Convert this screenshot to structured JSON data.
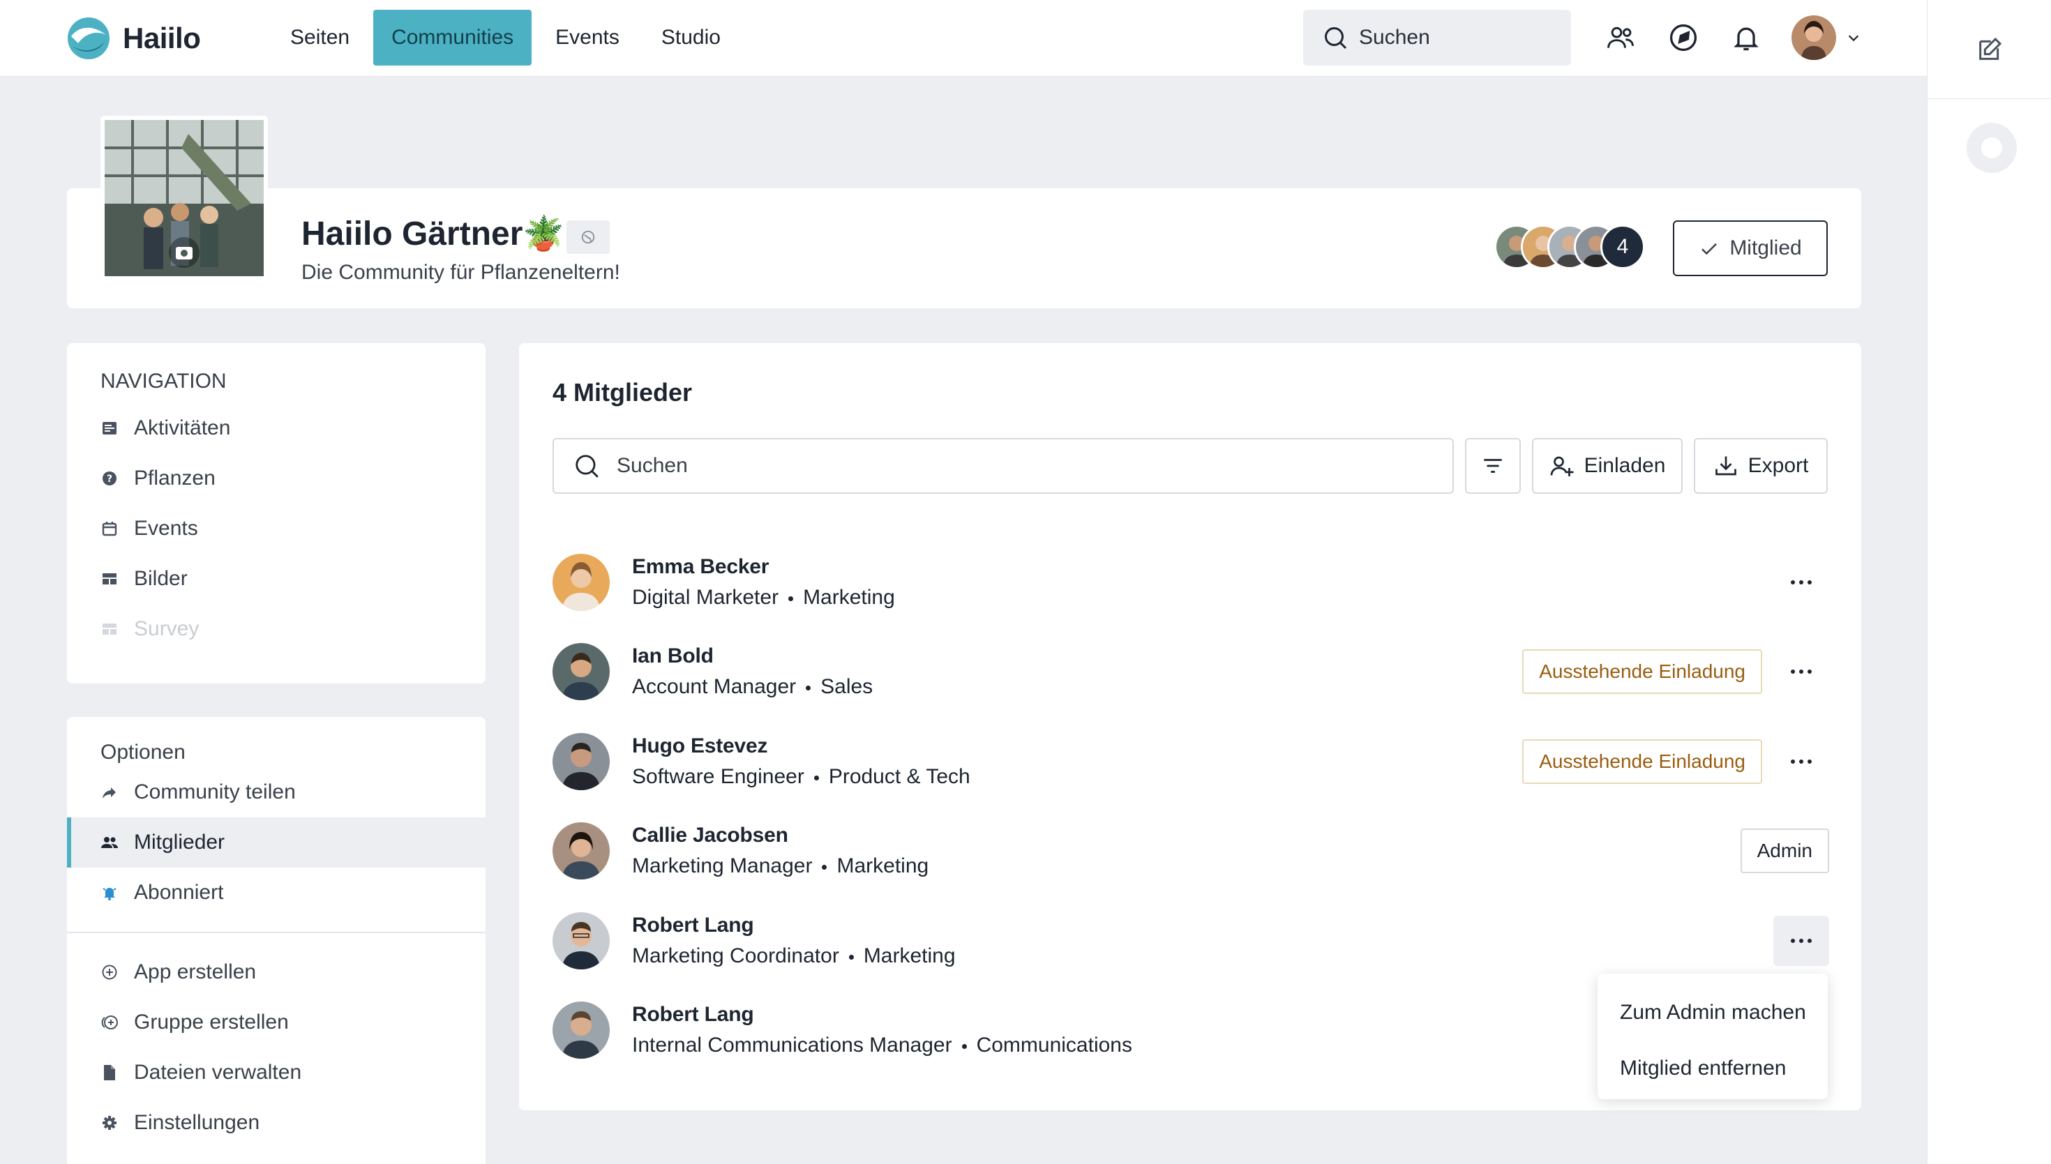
{
  "app": {
    "name": "Haiilo"
  },
  "nav": {
    "items": [
      "Seiten",
      "Communities",
      "Events",
      "Studio"
    ],
    "active": "Communities"
  },
  "top_search": {
    "placeholder": "Suchen"
  },
  "community": {
    "title": "Haiilo Gärtner🪴",
    "subtitle": "Die Community für Pflanzeneltern!",
    "member_count_badge": "4",
    "member_button": "Mitglied"
  },
  "sidebar": {
    "navigation_heading": "NAVIGATION",
    "navigation_items": [
      {
        "label": "Aktivitäten",
        "icon": "activity-icon"
      },
      {
        "label": "Pflanzen",
        "icon": "help-circle-icon"
      },
      {
        "label": "Events",
        "icon": "calendar-icon"
      },
      {
        "label": "Bilder",
        "icon": "gallery-icon"
      },
      {
        "label": "Survey",
        "icon": "list-icon",
        "disabled": true
      }
    ],
    "options_heading": "Optionen",
    "option_items": [
      {
        "label": "Community teilen",
        "icon": "share-icon"
      },
      {
        "label": "Mitglieder",
        "icon": "members-icon",
        "active": true
      },
      {
        "label": "Abonniert",
        "icon": "bell-icon"
      }
    ],
    "create_items": [
      {
        "label": "App erstellen",
        "icon": "plus-circle-icon"
      },
      {
        "label": "Gruppe erstellen",
        "icon": "group-add-icon"
      },
      {
        "label": "Dateien verwalten",
        "icon": "file-icon"
      },
      {
        "label": "Einstellungen",
        "icon": "settings-icon"
      }
    ]
  },
  "members": {
    "title": "4 Mitglieder",
    "search_placeholder": "Suchen",
    "invite_label": "Einladen",
    "export_label": "Export",
    "pending_label": "Ausstehende Einladung",
    "admin_label": "Admin",
    "list": [
      {
        "name": "Emma Becker",
        "title": "Digital Marketer",
        "dept": "Marketing",
        "status": ""
      },
      {
        "name": "Ian Bold",
        "title": "Account Manager",
        "dept": "Sales",
        "status": "pending"
      },
      {
        "name": "Hugo Estevez",
        "title": "Software Engineer",
        "dept": "Product & Tech",
        "status": "pending"
      },
      {
        "name": "Callie Jacobsen",
        "title": "Marketing Manager",
        "dept": "Marketing",
        "status": "admin"
      },
      {
        "name": "Robert Lang",
        "title": "Marketing Coordinator",
        "dept": "Marketing",
        "status": "menu-open"
      },
      {
        "name": "Robert Lang",
        "title": "Internal Communications Manager",
        "dept": "Communications",
        "status": ""
      }
    ]
  },
  "context_menu": {
    "items": [
      "Zum Admin machen",
      "Mitglied entfernen"
    ]
  },
  "colors": {
    "accent": "#4bb1c3",
    "pending": "#9a5d10",
    "background": "#eceef2"
  }
}
